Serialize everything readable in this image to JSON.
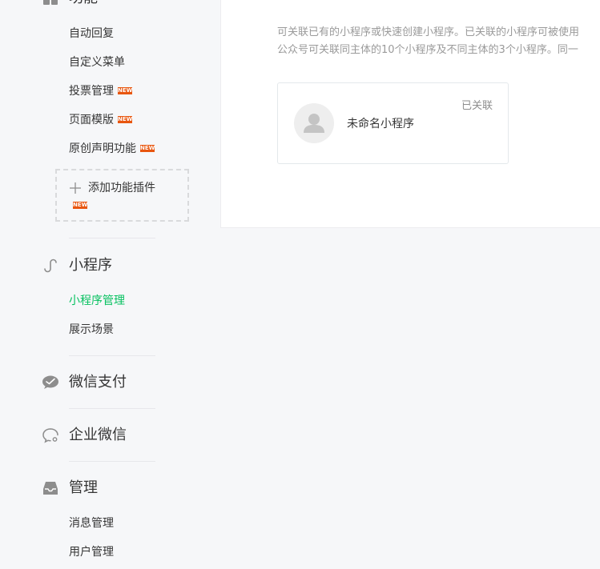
{
  "sidebar": {
    "func_group": {
      "title": "功能",
      "items": [
        {
          "label": "自动回复",
          "new": false
        },
        {
          "label": "自定义菜单",
          "new": false
        },
        {
          "label": "投票管理",
          "new": true
        },
        {
          "label": "页面模版",
          "new": true
        },
        {
          "label": "原创声明功能",
          "new": true
        }
      ],
      "add_plugin": {
        "label": "添加功能插件",
        "new": true
      }
    },
    "badge_text": "NEW",
    "miniprogram_group": {
      "title": "小程序",
      "items": [
        {
          "label": "小程序管理",
          "active": true
        },
        {
          "label": "展示场景",
          "active": false
        }
      ]
    },
    "wechat_pay": {
      "title": "微信支付"
    },
    "work_wechat": {
      "title": "企业微信"
    },
    "manage_group": {
      "title": "管理",
      "items": [
        {
          "label": "消息管理"
        },
        {
          "label": "用户管理"
        }
      ]
    }
  },
  "main": {
    "description": {
      "line1": "可关联已有的小程序或快速创建小程序。已关联的小程序可被使用",
      "line2": "公众号可关联同主体的10个小程序及不同主体的3个小程序。同一"
    },
    "card": {
      "name": "未命名小程序",
      "status": "已关联"
    }
  },
  "colors": {
    "accent": "#07c160",
    "badge": "#e8560f",
    "text": "#353535",
    "muted": "#9a9a9a",
    "background": "#f6f7f9"
  }
}
